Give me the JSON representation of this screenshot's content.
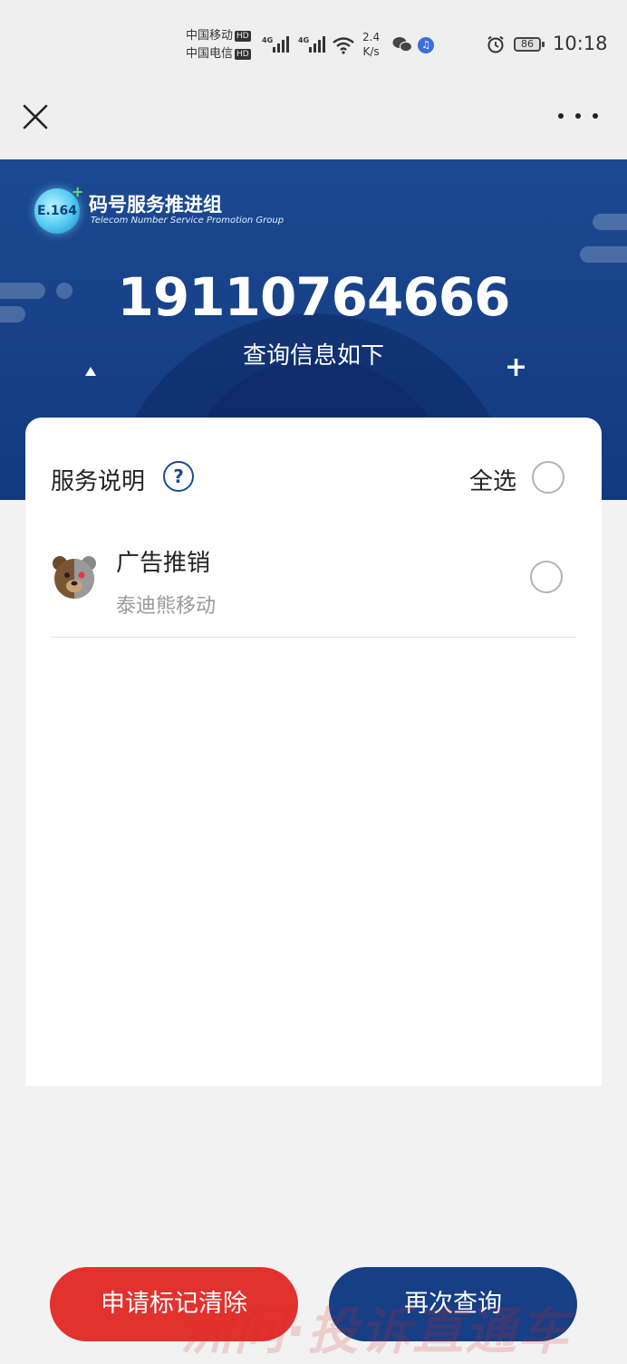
{
  "status_bar": {
    "carrier1": "中国移动",
    "carrier2": "中国电信",
    "hd": "HD",
    "net1": "4G",
    "net2": "4G",
    "speed_value": "2.4",
    "speed_unit": "K/s",
    "battery": "86",
    "time": "10:18"
  },
  "navbar": {
    "close_icon": "close-icon",
    "more_icon": "more-dots-icon"
  },
  "banner": {
    "org_name_cn": "码号服务推进组",
    "org_name_en": "Telecom Number Service  Promotion Group",
    "logo_text": "E.164",
    "phone_number": "19110764666",
    "subtitle": "查询信息如下"
  },
  "card": {
    "title": "服务说明",
    "help_icon": "question-mark",
    "select_all_label": "全选",
    "items": [
      {
        "title": "广告推销",
        "subtitle": "泰迪熊移动",
        "selected": false
      }
    ]
  },
  "buttons": {
    "clear_label": "申请标记清除",
    "requery_label": "再次查询"
  },
  "watermark": "洲问·投诉直通车",
  "colors": {
    "brand_blue": "#1c4a92",
    "accent_red": "#e2322e"
  }
}
